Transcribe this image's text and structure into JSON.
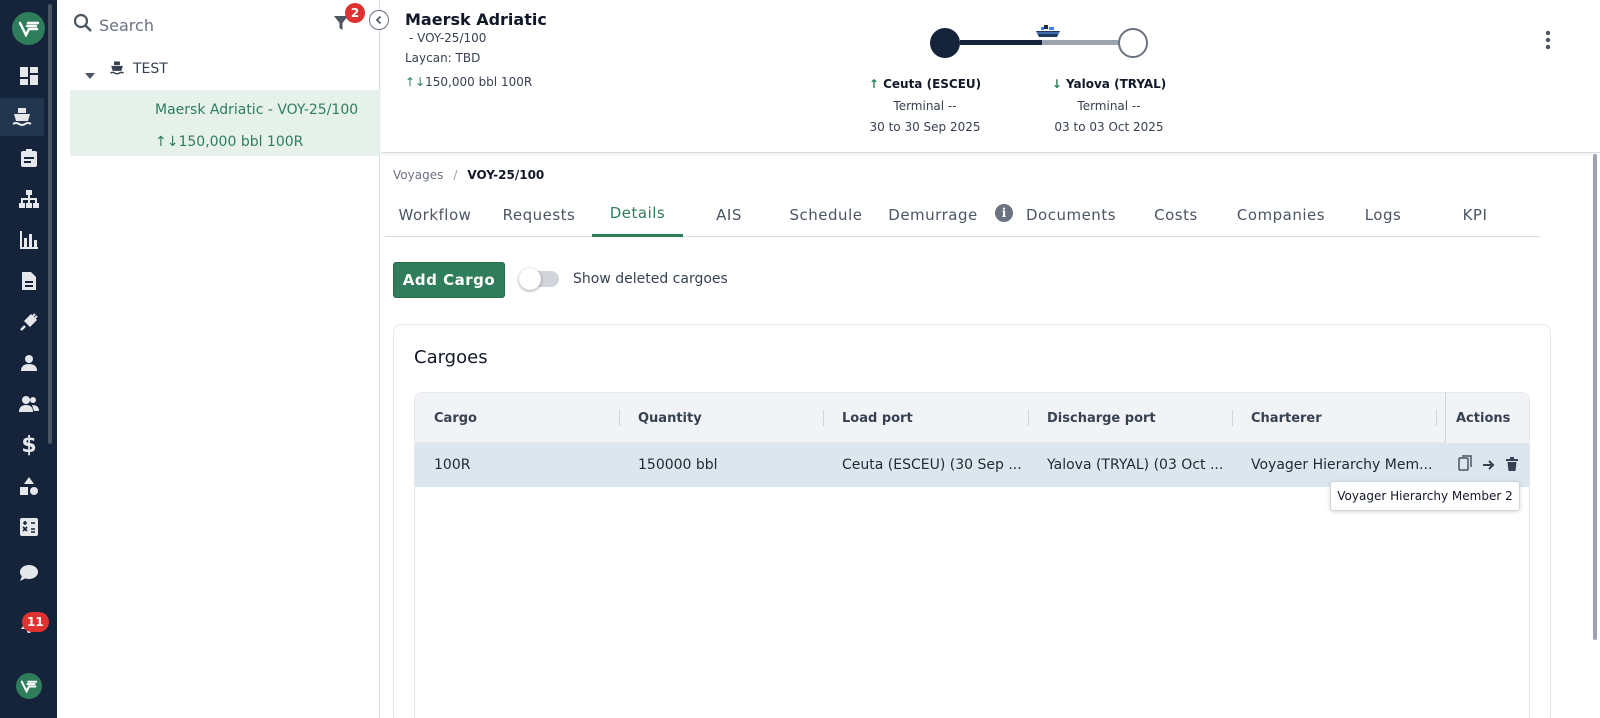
{
  "rail": {
    "notifications_count": "11",
    "icons": [
      "dashboard-icon",
      "ship-icon",
      "clipboard-icon",
      "hierarchy-icon",
      "bar-chart-icon",
      "document-icon",
      "plug-icon",
      "person-icon",
      "people-icon",
      "dollar-icon",
      "shapes-icon",
      "calculator-icon",
      "chat-icon",
      "bell-icon"
    ]
  },
  "sidebar": {
    "search_placeholder": "Search",
    "filter_count": "2",
    "group_name": "TEST",
    "selected_voyage": "Maersk Adriatic - VOY-25/100",
    "selected_qty": "150,000 bbl 100R"
  },
  "header": {
    "vessel": "Maersk Adriatic",
    "voyage": "- VOY-25/100",
    "laycan": "Laycan: TBD",
    "qty": "150,000 bbl 100R",
    "load_port": {
      "name": "Ceuta (ESCEU)",
      "terminal": "Terminal --",
      "dates": "30 to 30 Sep 2025"
    },
    "discharge_port": {
      "name": "Yalova (TRYAL)",
      "terminal": "Terminal --",
      "dates": "03 to 03 Oct 2025"
    }
  },
  "breadcrumb": {
    "root": "Voyages",
    "separator": "/",
    "current": "VOY-25/100"
  },
  "tabs": [
    "Workflow",
    "Requests",
    "Details",
    "AIS",
    "Schedule",
    "Demurrage",
    "Documents",
    "Costs",
    "Companies",
    "Logs",
    "KPI"
  ],
  "active_tab": "Details",
  "actions": {
    "add_cargo": "Add Cargo",
    "show_deleted": "Show deleted cargoes"
  },
  "cargoes": {
    "title": "Cargoes",
    "columns": [
      "Cargo",
      "Quantity",
      "Load port",
      "Discharge port",
      "Charterer",
      "Actions"
    ],
    "rows": [
      {
        "cargo": "100R",
        "quantity": "150000 bbl",
        "load_port": "Ceuta (ESCEU) (30 Sep ...",
        "discharge_port": "Yalova (TRYAL) (03 Oct ...",
        "charterer": "Voyager Hierarchy Mem..."
      }
    ]
  },
  "tooltip": "Voyager Hierarchy Member 2",
  "colors": {
    "rail_bg": "#15243a",
    "accent": "#2f7d5a",
    "badge": "#e03131",
    "row_selected": "#dbe6ef"
  }
}
